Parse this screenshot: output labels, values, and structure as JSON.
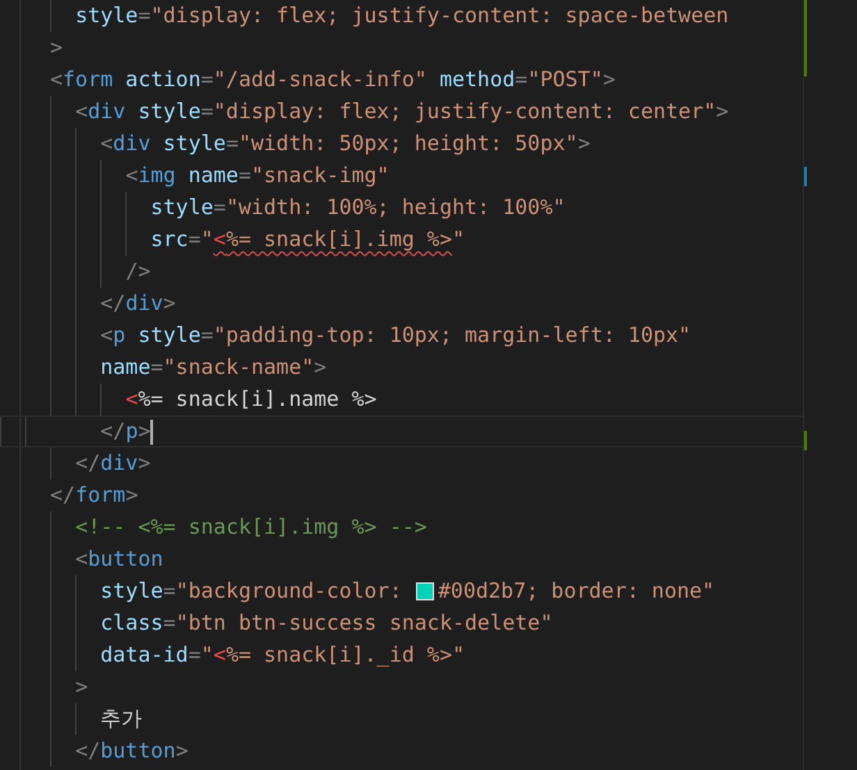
{
  "editor": {
    "lines": [
      {
        "tokens": [
          {
            "kind": "attr",
            "text": "  style"
          },
          {
            "kind": "punct",
            "text": "="
          },
          {
            "kind": "string",
            "text": "\"display: flex; justify-content: space-between"
          }
        ]
      },
      {
        "tokens": [
          {
            "kind": "punct",
            "text": ">"
          }
        ]
      },
      {
        "tokens": [
          {
            "kind": "punct",
            "text": "<"
          },
          {
            "kind": "tag",
            "text": "form"
          },
          {
            "kind": "attr",
            "text": " action"
          },
          {
            "kind": "punct",
            "text": "="
          },
          {
            "kind": "string",
            "text": "\"/add-snack-info\""
          },
          {
            "kind": "attr",
            "text": " method"
          },
          {
            "kind": "punct",
            "text": "="
          },
          {
            "kind": "string",
            "text": "\"POST\""
          },
          {
            "kind": "punct",
            "text": ">"
          }
        ]
      },
      {
        "tokens": [
          {
            "kind": "punct",
            "text": "  <"
          },
          {
            "kind": "tag",
            "text": "div"
          },
          {
            "kind": "attr",
            "text": " style"
          },
          {
            "kind": "punct",
            "text": "="
          },
          {
            "kind": "string",
            "text": "\"display: flex; justify-content: center\""
          },
          {
            "kind": "punct",
            "text": ">"
          }
        ]
      },
      {
        "tokens": [
          {
            "kind": "punct",
            "text": "    <"
          },
          {
            "kind": "tag",
            "text": "div"
          },
          {
            "kind": "attr",
            "text": " style"
          },
          {
            "kind": "punct",
            "text": "="
          },
          {
            "kind": "string",
            "text": "\"width: 50px; height: 50px\""
          },
          {
            "kind": "punct",
            "text": ">"
          }
        ]
      },
      {
        "tokens": [
          {
            "kind": "punct",
            "text": "      <"
          },
          {
            "kind": "tag",
            "text": "img"
          },
          {
            "kind": "attr",
            "text": " name"
          },
          {
            "kind": "punct",
            "text": "="
          },
          {
            "kind": "string",
            "text": "\"snack-img\""
          }
        ]
      },
      {
        "tokens": [
          {
            "kind": "attr",
            "text": "        style"
          },
          {
            "kind": "punct",
            "text": "="
          },
          {
            "kind": "string",
            "text": "\"width: 100%; height: 100%\""
          }
        ]
      },
      {
        "tokens": [
          {
            "kind": "attr",
            "text": "        src"
          },
          {
            "kind": "punct",
            "text": "="
          },
          {
            "kind": "string",
            "text": "\""
          },
          {
            "kind": "ejs-string",
            "text": "<%= snack[i].img %>",
            "error": true
          },
          {
            "kind": "string",
            "text": "\""
          }
        ]
      },
      {
        "tokens": [
          {
            "kind": "punct",
            "text": "      />"
          }
        ]
      },
      {
        "tokens": [
          {
            "kind": "punct",
            "text": "    </"
          },
          {
            "kind": "tag",
            "text": "div"
          },
          {
            "kind": "punct",
            "text": ">"
          }
        ]
      },
      {
        "tokens": [
          {
            "kind": "punct",
            "text": "    <"
          },
          {
            "kind": "tag",
            "text": "p"
          },
          {
            "kind": "attr",
            "text": " style"
          },
          {
            "kind": "punct",
            "text": "="
          },
          {
            "kind": "string",
            "text": "\"padding-top: 10px; margin-left: 10px\""
          }
        ]
      },
      {
        "tokens": [
          {
            "kind": "attr",
            "text": "    name"
          },
          {
            "kind": "punct",
            "text": "="
          },
          {
            "kind": "string",
            "text": "\"snack-name\""
          },
          {
            "kind": "punct",
            "text": ">"
          }
        ]
      },
      {
        "tokens": [
          {
            "kind": "ejs-text",
            "text": "      <%= snack[i].name %>"
          }
        ]
      },
      {
        "current": true,
        "tokens": [
          {
            "kind": "punct",
            "text": "    </"
          },
          {
            "kind": "tag",
            "text": "p"
          },
          {
            "kind": "punct",
            "text": ">"
          }
        ]
      },
      {
        "tokens": [
          {
            "kind": "punct",
            "text": "  </"
          },
          {
            "kind": "tag",
            "text": "div"
          },
          {
            "kind": "punct",
            "text": ">"
          }
        ]
      },
      {
        "tokens": [
          {
            "kind": "punct",
            "text": "</"
          },
          {
            "kind": "tag",
            "text": "form"
          },
          {
            "kind": "punct",
            "text": ">"
          }
        ]
      },
      {
        "tokens": [
          {
            "kind": "comment",
            "text": "  <!-- <%= snack[i].img %> -->"
          }
        ]
      },
      {
        "tokens": [
          {
            "kind": "punct",
            "text": "  <"
          },
          {
            "kind": "tag",
            "text": "button"
          }
        ]
      },
      {
        "tokens": [
          {
            "kind": "attr",
            "text": "    style"
          },
          {
            "kind": "punct",
            "text": "="
          },
          {
            "kind": "string",
            "text": "\"background-color: "
          },
          {
            "kind": "swatch",
            "color": "#00d2b7"
          },
          {
            "kind": "string",
            "text": "#00d2b7; border: none\""
          }
        ]
      },
      {
        "tokens": [
          {
            "kind": "attr",
            "text": "    class"
          },
          {
            "kind": "punct",
            "text": "="
          },
          {
            "kind": "string",
            "text": "\"btn btn-success snack-delete\""
          }
        ]
      },
      {
        "tokens": [
          {
            "kind": "attr",
            "text": "    data-id"
          },
          {
            "kind": "punct",
            "text": "="
          },
          {
            "kind": "string",
            "text": "\""
          },
          {
            "kind": "ejs-string",
            "text": "<%= snack[i]._id %>\""
          }
        ]
      },
      {
        "tokens": [
          {
            "kind": "punct",
            "text": "  >"
          }
        ]
      },
      {
        "tokens": [
          {
            "kind": "text",
            "text": "    추가"
          }
        ]
      },
      {
        "tokens": [
          {
            "kind": "punct",
            "text": "  </"
          },
          {
            "kind": "tag",
            "text": "button"
          },
          {
            "kind": "punct",
            "text": ">"
          }
        ]
      }
    ]
  }
}
